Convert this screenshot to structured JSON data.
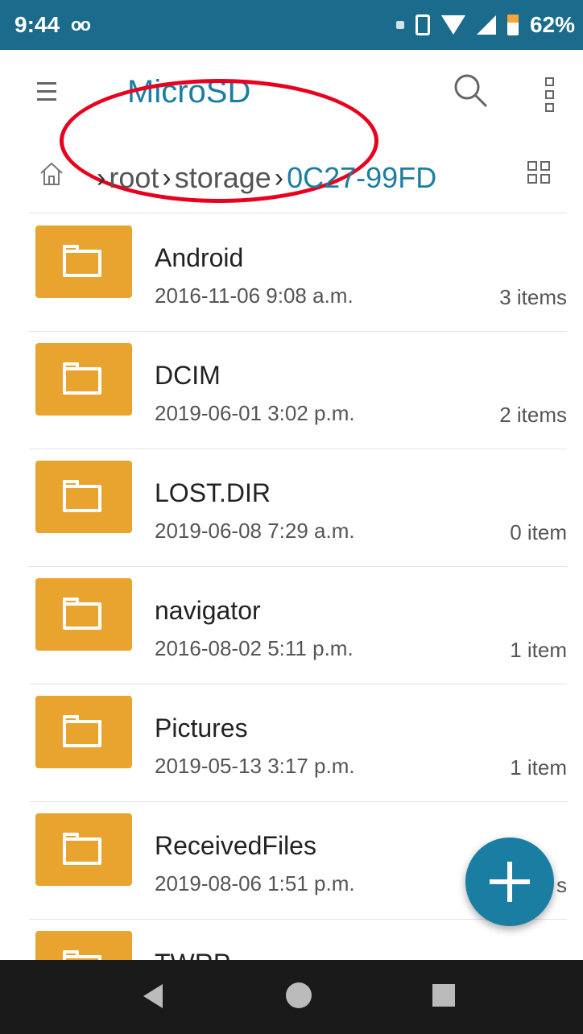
{
  "status_bar": {
    "time": "9:44",
    "voicemail_icon": "oo",
    "battery": "62%",
    "icons": [
      "notification-dot-icon",
      "vibrate-icon",
      "wifi-icon",
      "signal-icon",
      "battery-icon"
    ]
  },
  "app_bar": {
    "title": "MicroSD",
    "icons": [
      "menu-icon",
      "search-icon",
      "more-vert-icon"
    ]
  },
  "breadcrumb": {
    "home_icon": "home-icon",
    "segments": [
      {
        "label": "root"
      },
      {
        "label": "storage"
      },
      {
        "label": "0C27-99FD"
      }
    ],
    "view_toggle_icon": "grid-view-icon"
  },
  "files": [
    {
      "name": "Android",
      "date": "2016-11-06 9:08 a.m.",
      "count": "3 items"
    },
    {
      "name": "DCIM",
      "date": "2019-06-01 3:02 p.m.",
      "count": "2 items"
    },
    {
      "name": "LOST.DIR",
      "date": "2019-06-08 7:29 a.m.",
      "count": "0 item"
    },
    {
      "name": "navigator",
      "date": "2016-08-02 5:11 p.m.",
      "count": "1 item"
    },
    {
      "name": "Pictures",
      "date": "2019-05-13 3:17 p.m.",
      "count": "1 item"
    },
    {
      "name": "ReceivedFiles",
      "date": "2019-08-06 1:51 p.m.",
      "count": "s"
    },
    {
      "name": "TWRP",
      "date": "",
      "count": ""
    }
  ],
  "fab": {
    "icon": "plus-icon"
  },
  "nav_bar": {
    "icons": [
      "back-icon",
      "home-circle-icon",
      "recents-icon"
    ]
  },
  "colors": {
    "status_bar": "#1a6b8c",
    "accent": "#1a7ea3",
    "folder": "#e9a430",
    "annotation": "#e8001e",
    "nav_bar": "#1a1a1a"
  }
}
